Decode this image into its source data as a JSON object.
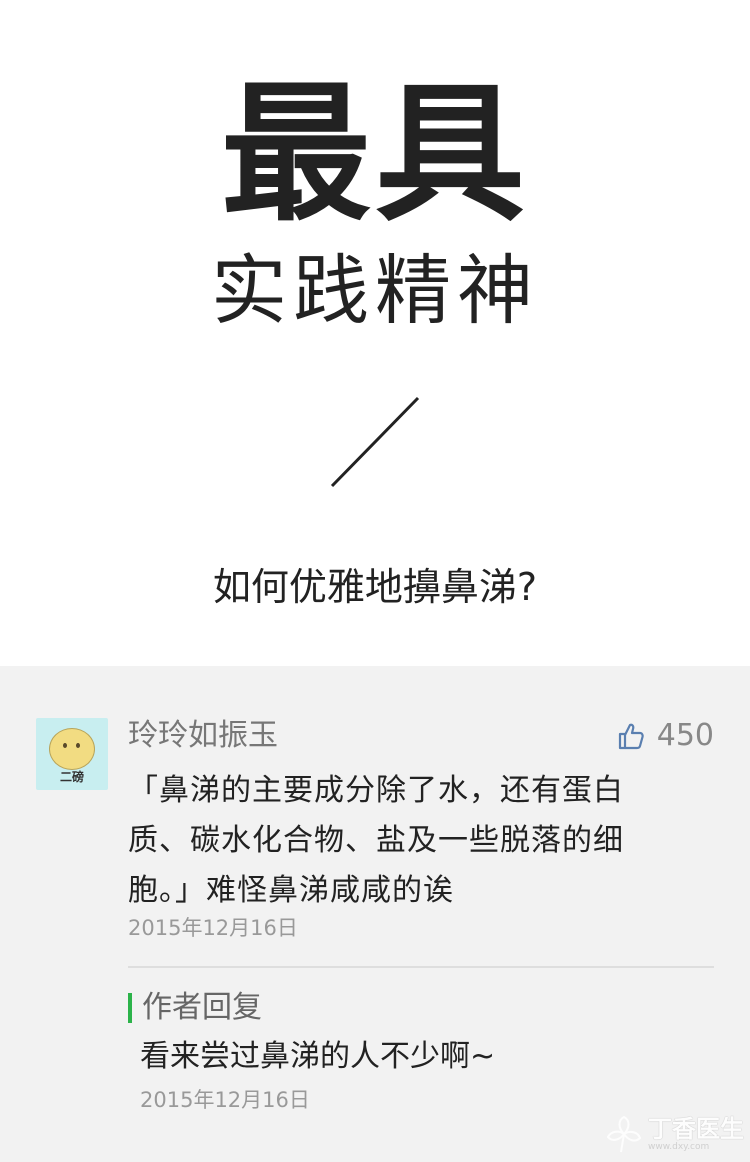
{
  "hero": {
    "title_big": "最具",
    "title_sub": "实践精神",
    "question": "如何优雅地擤鼻涕?"
  },
  "comment": {
    "avatar_caption": "二磅",
    "username": "玲玲如振玉",
    "like_count": "450",
    "text": "「鼻涕的主要成分除了水，还有蛋白质、碳水化合物、盐及一些脱落的细胞。」难怪鼻涕咸咸的诶",
    "date": "2015年12月16日"
  },
  "reply": {
    "label": "作者回复",
    "text": "看来尝过鼻涕的人不少啊~",
    "date": "2015年12月16日"
  },
  "watermark": {
    "name": "丁香医生",
    "url": "www.dxy.com"
  },
  "icons": {
    "like": "thumbs-up-icon",
    "slash": "slash-divider-icon"
  },
  "colors": {
    "panel_background": "#f2f2f2",
    "reply_accent": "#2cb34a",
    "like_icon": "#5a7fb0",
    "avatar_background": "#c8eef0"
  }
}
